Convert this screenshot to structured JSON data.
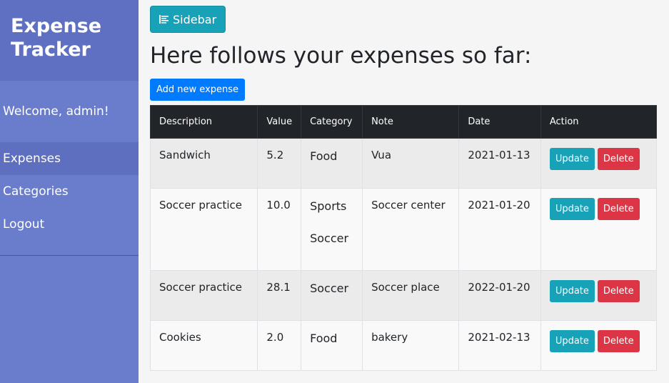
{
  "sidebar": {
    "title_line1": "Expense",
    "title_line2": "Tracker",
    "welcome": "Welcome, admin!",
    "items": [
      {
        "label": "Expenses",
        "active": true
      },
      {
        "label": "Categories",
        "active": false
      },
      {
        "label": "Logout",
        "active": false
      }
    ]
  },
  "toolbar": {
    "sidebar_toggle_label": "Sidebar",
    "sidebar_toggle_icon": "align-left-icon"
  },
  "main": {
    "title": "Here follows your expenses so far:",
    "add_button_label": "Add new expense"
  },
  "table": {
    "headers": [
      "Description",
      "Value",
      "Category",
      "Note",
      "Date",
      "Action"
    ],
    "rows": [
      {
        "description": "Sandwich",
        "value": "5.2",
        "categories": [
          "Food"
        ],
        "note": "Vua",
        "date": "2021-01-13",
        "update": "Update",
        "delete": "Delete"
      },
      {
        "description": "Soccer practice",
        "value": "10.0",
        "categories": [
          "Sports",
          "Soccer"
        ],
        "note": "Soccer center",
        "date": "2021-01-20",
        "update": "Update",
        "delete": "Delete"
      },
      {
        "description": "Soccer practice",
        "value": "28.1",
        "categories": [
          "Soccer"
        ],
        "note": "Soccer place",
        "date": "2022-01-20",
        "update": "Update",
        "delete": "Delete"
      },
      {
        "description": "Cookies",
        "value": "2.0",
        "categories": [
          "Food"
        ],
        "note": "bakery",
        "date": "2021-02-13",
        "update": "Update",
        "delete": "Delete"
      }
    ]
  },
  "colors": {
    "sidebar_bg": "#6a7ccc",
    "sidebar_header_bg": "#5f70c2",
    "info": "#17a2b8",
    "primary": "#007bff",
    "danger": "#dc3545",
    "table_header": "#212529"
  }
}
